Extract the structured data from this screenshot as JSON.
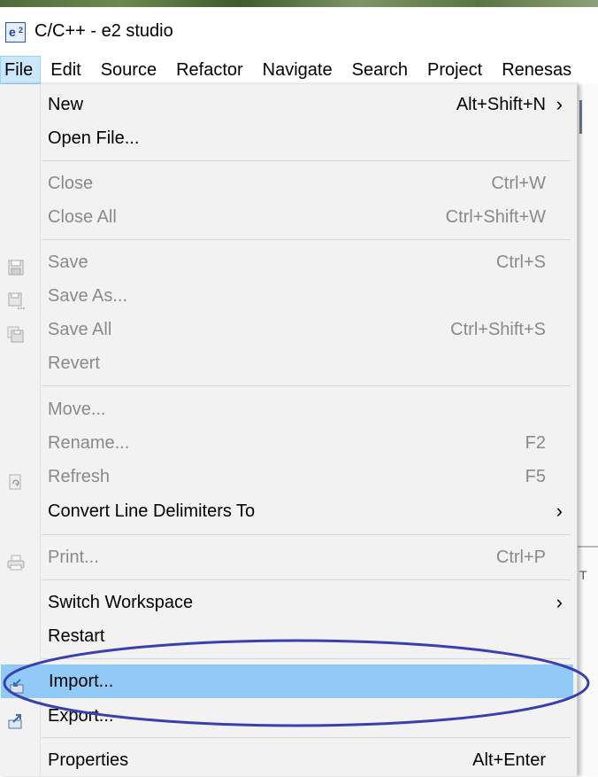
{
  "window": {
    "title": "C/C++ - e2 studio",
    "icon": "e2-studio-icon"
  },
  "menubar": [
    "File",
    "Edit",
    "Source",
    "Refactor",
    "Navigate",
    "Search",
    "Project",
    "Renesas"
  ],
  "file_menu": {
    "new": {
      "label": "New",
      "shortcut": "Alt+Shift+N"
    },
    "open_file": {
      "label": "Open File..."
    },
    "close": {
      "label": "Close",
      "shortcut": "Ctrl+W"
    },
    "close_all": {
      "label": "Close All",
      "shortcut": "Ctrl+Shift+W"
    },
    "save": {
      "label": "Save",
      "shortcut": "Ctrl+S"
    },
    "save_as": {
      "label": "Save As..."
    },
    "save_all": {
      "label": "Save All",
      "shortcut": "Ctrl+Shift+S"
    },
    "revert": {
      "label": "Revert"
    },
    "move": {
      "label": "Move..."
    },
    "rename": {
      "label": "Rename...",
      "shortcut": "F2"
    },
    "refresh": {
      "label": "Refresh",
      "shortcut": "F5"
    },
    "convert": {
      "label": "Convert Line Delimiters To"
    },
    "print": {
      "label": "Print...",
      "shortcut": "Ctrl+P"
    },
    "switch_workspace": {
      "label": "Switch Workspace"
    },
    "restart": {
      "label": "Restart"
    },
    "import": {
      "label": "Import..."
    },
    "export": {
      "label": "Export..."
    },
    "properties": {
      "label": "Properties",
      "shortcut": "Alt+Enter"
    }
  },
  "colors": {
    "highlight": "#91c9f7",
    "annotation_ellipse": "#3a3fb0"
  }
}
